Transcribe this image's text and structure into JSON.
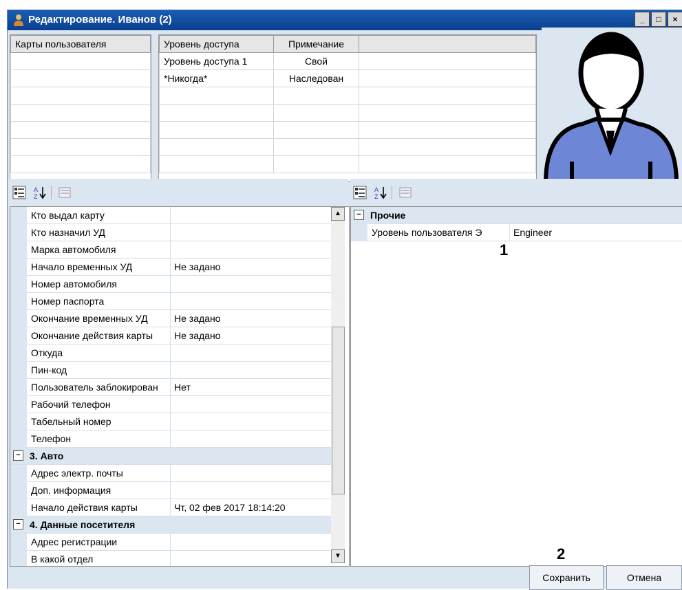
{
  "window": {
    "title": "Редактирование. Иванов (2)",
    "controls": [
      "_",
      "□",
      "×"
    ]
  },
  "cards_grid": {
    "header": "Карты пользователя",
    "rows": [
      "",
      "",
      "",
      "",
      "",
      "",
      ""
    ]
  },
  "access_grid": {
    "headers": [
      "Уровень доступа",
      "Примечание"
    ],
    "rows": [
      {
        "level": "Уровень доступа 1",
        "note": "Свой"
      },
      {
        "level": "*Никогда*",
        "note": "Наследован"
      },
      {
        "level": "",
        "note": ""
      },
      {
        "level": "",
        "note": ""
      },
      {
        "level": "",
        "note": ""
      },
      {
        "level": "",
        "note": ""
      },
      {
        "level": "",
        "note": ""
      }
    ]
  },
  "toolbar_icons": [
    "categorized-icon",
    "sort-az-icon",
    "property-pages-icon"
  ],
  "left_props": [
    {
      "type": "prop",
      "name": "Кто выдал карту",
      "value": ""
    },
    {
      "type": "prop",
      "name": "Кто назначил УД",
      "value": ""
    },
    {
      "type": "prop",
      "name": "Марка автомобиля",
      "value": ""
    },
    {
      "type": "prop",
      "name": "Начало временных УД",
      "value": "Не задано"
    },
    {
      "type": "prop",
      "name": "Номер автомобиля",
      "value": ""
    },
    {
      "type": "prop",
      "name": "Номер паспорта",
      "value": ""
    },
    {
      "type": "prop",
      "name": "Окончание временных УД",
      "value": "Не задано"
    },
    {
      "type": "prop",
      "name": "Окончание действия карты",
      "value": "Не задано"
    },
    {
      "type": "prop",
      "name": "Откуда",
      "value": ""
    },
    {
      "type": "prop",
      "name": "Пин-код",
      "value": ""
    },
    {
      "type": "prop",
      "name": "Пользователь заблокирован",
      "value": "Нет"
    },
    {
      "type": "prop",
      "name": "Рабочий телефон",
      "value": ""
    },
    {
      "type": "prop",
      "name": "Табельный номер",
      "value": ""
    },
    {
      "type": "prop",
      "name": "Телефон",
      "value": ""
    },
    {
      "type": "cat",
      "name": "3. Авто",
      "value": ""
    },
    {
      "type": "prop",
      "name": "Адрес электр. почты",
      "value": ""
    },
    {
      "type": "prop",
      "name": "Доп. информация",
      "value": ""
    },
    {
      "type": "prop",
      "name": "Начало действия карты",
      "value": "Чт, 02 фев 2017 18:14:20"
    },
    {
      "type": "cat",
      "name": "4. Данные посетителя",
      "value": ""
    },
    {
      "type": "prop",
      "name": "Адрес регистрации",
      "value": ""
    },
    {
      "type": "prop",
      "name": "В какой отдел",
      "value": ""
    }
  ],
  "right_props": [
    {
      "type": "cat",
      "name": "Прочие",
      "value": ""
    },
    {
      "type": "prop",
      "name": "Уровень пользователя Э",
      "value": "Engineer"
    }
  ],
  "markers": {
    "one": "1",
    "two": "2"
  },
  "buttons": {
    "save": "Сохранить",
    "cancel": "Отмена"
  },
  "colors": {
    "title_bar": "#0b3f8f",
    "panel_bg": "#dce6f0",
    "avatar_shirt": "#6e86d6"
  }
}
